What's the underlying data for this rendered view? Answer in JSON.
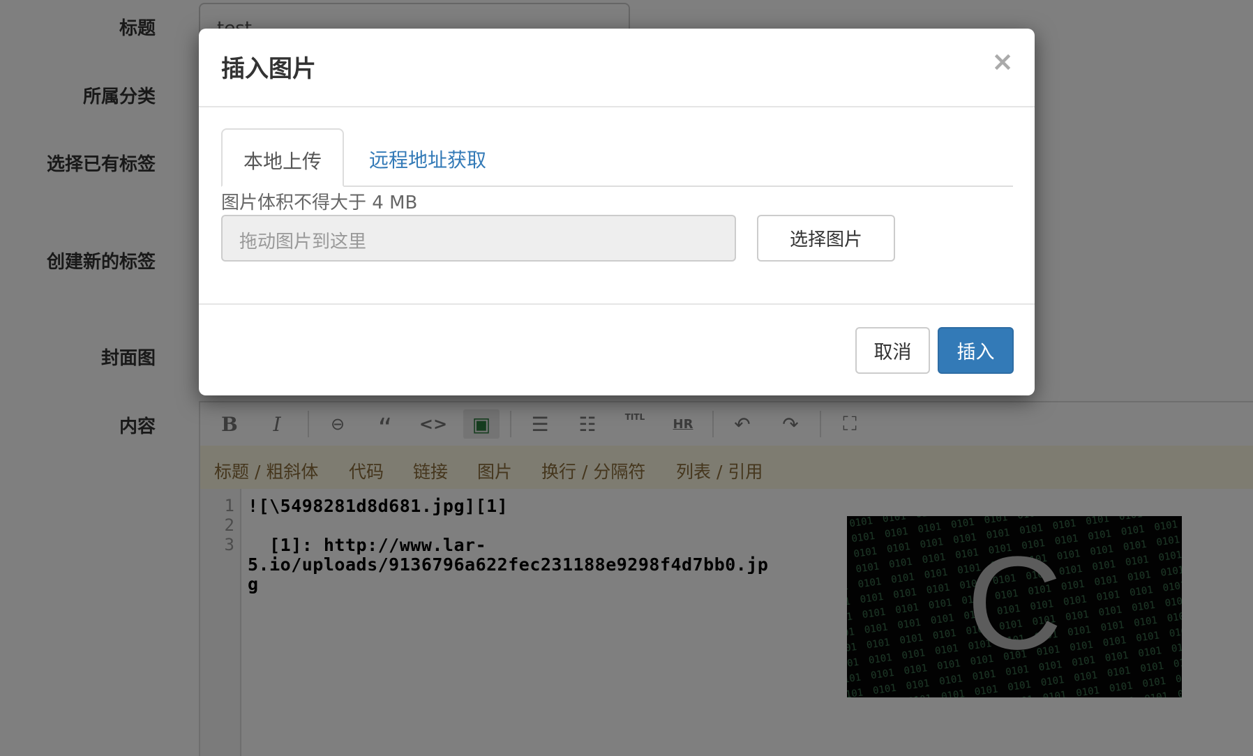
{
  "form": {
    "labels": {
      "title": "标题",
      "category": "所属分类",
      "existing_tags": "选择已有标签",
      "new_tags": "创建新的标签",
      "cover": "封面图",
      "content": "内容"
    },
    "title_value": "test"
  },
  "editor": {
    "toolbar": [
      {
        "icon": "bold-icon",
        "glyph": "B"
      },
      {
        "icon": "italic-icon",
        "glyph": "I"
      },
      {
        "icon": "link-icon",
        "glyph": "⊖"
      },
      {
        "icon": "quote-icon",
        "glyph": "“"
      },
      {
        "icon": "code-icon",
        "glyph": "<>"
      },
      {
        "icon": "image-icon",
        "glyph": "▣"
      },
      {
        "icon": "ordered-list-icon",
        "glyph": "☰"
      },
      {
        "icon": "unordered-list-icon",
        "glyph": "☷"
      },
      {
        "icon": "title-icon",
        "glyph": "TITL"
      },
      {
        "icon": "hr-icon",
        "glyph": "HR"
      },
      {
        "icon": "undo-icon",
        "glyph": "↶"
      },
      {
        "icon": "redo-icon",
        "glyph": "↷"
      },
      {
        "icon": "fullscreen-icon",
        "glyph": "⛶"
      }
    ],
    "hints": [
      "标题 / 粗斜体",
      "代码",
      "链接",
      "图片",
      "换行 / 分隔符",
      "列表 / 引用"
    ],
    "line_numbers": [
      "1",
      "2",
      "3"
    ],
    "code_lines": [
      "![\\5498281d8d681.jpg][1]",
      "",
      "  [1]: http://www.lar-",
      "5.io/uploads/9136796a622fec231188e9298f4d7bb0.jp",
      "g"
    ],
    "preview_glyph": "C"
  },
  "modal": {
    "title": "插入图片",
    "close": "×",
    "tabs": [
      "本地上传",
      "远程地址获取"
    ],
    "size_note": "图片体积不得大于 4 MB",
    "drop_placeholder": "拖动图片到这里",
    "choose_label": "选择图片",
    "cancel_label": "取消",
    "insert_label": "插入"
  },
  "colors": {
    "primary": "#337ab7",
    "hint_bg": "#fcf8e3",
    "hint_text": "#8a6d3b"
  }
}
